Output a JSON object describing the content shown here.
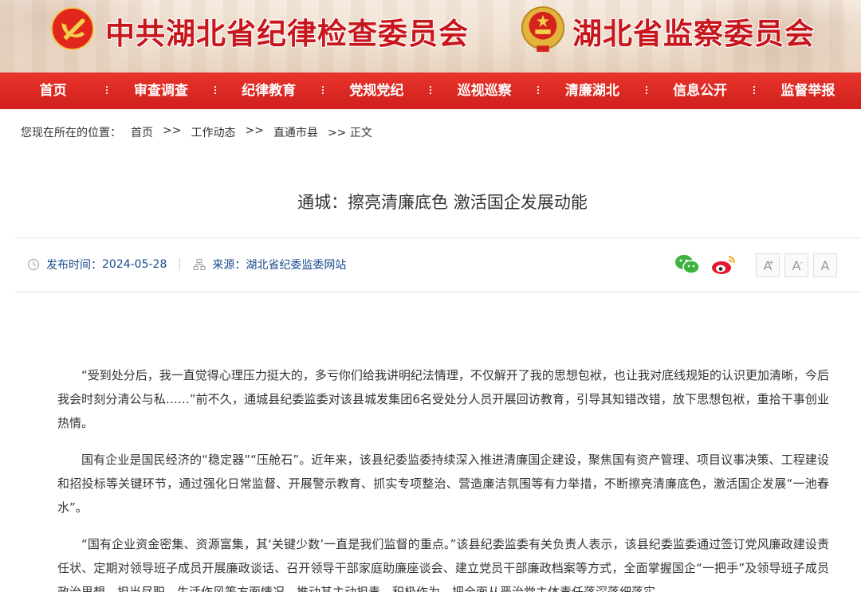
{
  "header": {
    "title_left": "中共湖北省纪律检查委员会",
    "title_right": "湖北省监察委员会",
    "emblem_left": "party-emblem-icon",
    "emblem_right": "national-emblem-icon",
    "brand_red": "#c8161d"
  },
  "nav": {
    "items": [
      {
        "label": "首页"
      },
      {
        "label": "审查调查"
      },
      {
        "label": "纪律教育"
      },
      {
        "label": "党规党纪"
      },
      {
        "label": "巡视巡察"
      },
      {
        "label": "清廉湖北"
      },
      {
        "label": "信息公开"
      },
      {
        "label": "监督举报"
      }
    ],
    "bg_color": "#d9261f"
  },
  "breadcrumb": {
    "prefix": "您现在所在的位置：",
    "items": [
      "首页",
      ">>",
      "工作动态",
      ">>",
      "直通市县",
      ">> 正文"
    ]
  },
  "article": {
    "title": "通城：擦亮清廉底色 激活国企发展动能",
    "publish_label": "发布时间：",
    "publish_date": "2024-05-28",
    "source_label": "来源：",
    "source_name": "湖北省纪委监委网站",
    "paragraphs": [
      "“受到处分后，我一直觉得心理压力挺大的，多亏你们给我讲明纪法情理，不仅解开了我的思想包袱，也让我对底线规矩的认识更加清晰，今后我会时刻分清公与私……”前不久，通城县纪委监委对该县城发集团6名受处分人员开展回访教育，引导其知错改错，放下思想包袱，重拾干事创业热情。",
      "国有企业是国民经济的“稳定器”“压舱石”。近年来，该县纪委监委持续深入推进清廉国企建设，聚焦国有资产管理、项目议事决策、工程建设和招投标等关键环节，通过强化日常监督、开展警示教育、抓实专项整治、营造廉洁氛围等有力举措，不断擦亮清廉底色，激活国企发展“一池春水”。",
      "“国有企业资金密集、资源富集，其‘关键少数’一直是我们监督的重点。”该县纪委监委有关负责人表示，该县纪委监委通过签订党风廉政建设责任状、定期对领导班子成员开展廉政谈话、召开领导干部家庭助廉座谈会、建立党员干部廉政档案等方式，全面掌握国企“一把手”及领导班子成员政治思想、担当尽职、生活作风等方面情况，推动其主动担责、积极作为，把全面从严治党主体责任落深落细落实。"
    ]
  },
  "share": {
    "wechat_icon": "wechat-icon",
    "weibo_icon": "weibo-icon"
  },
  "font_controls": {
    "increase": "A",
    "increase_sup": "+",
    "decrease": "A",
    "decrease_sup": "-",
    "reset": "A"
  }
}
